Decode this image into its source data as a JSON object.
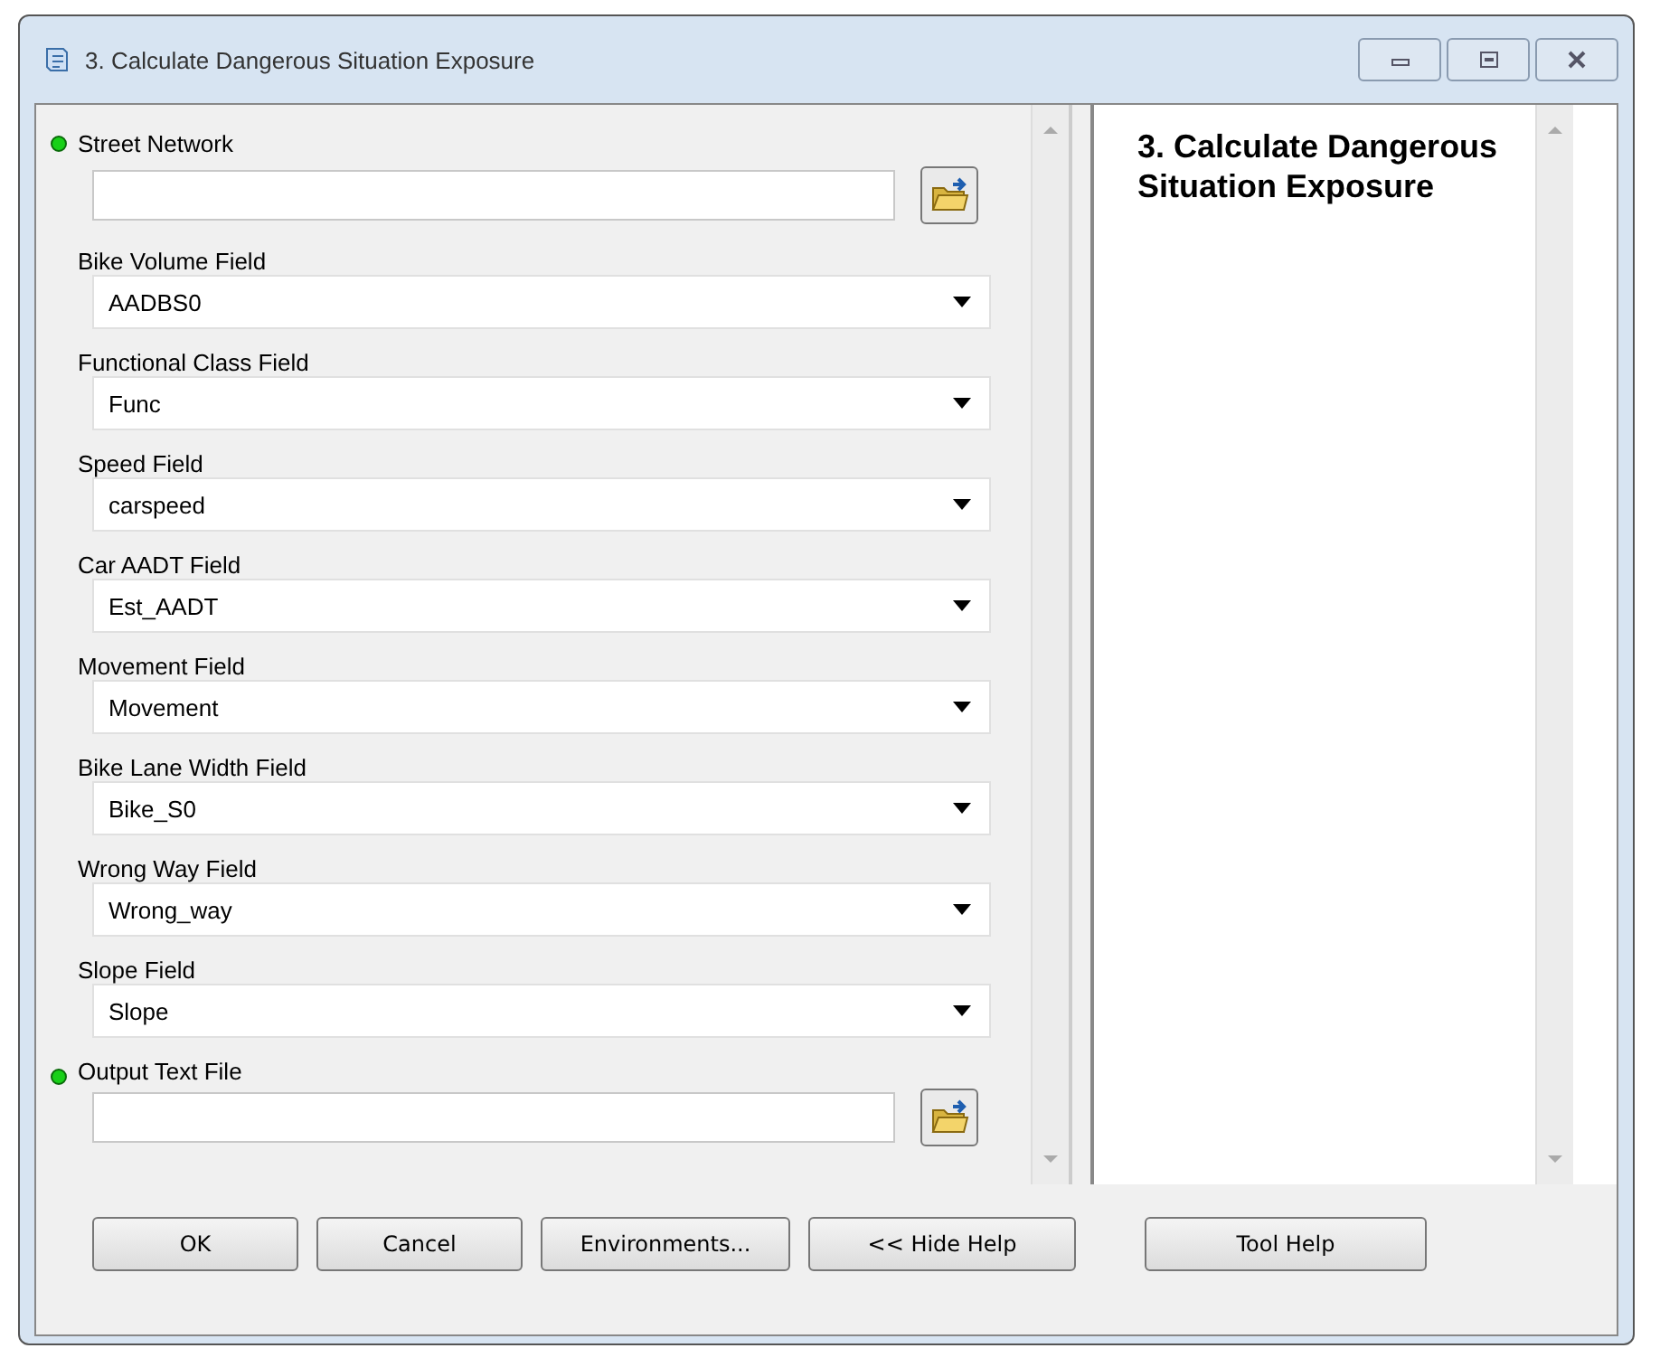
{
  "window": {
    "title": "3. Calculate Dangerous Situation Exposure"
  },
  "parameters": [
    {
      "kind": "file",
      "label": "Street Network",
      "required": true
    },
    {
      "kind": "dropdown",
      "label": "Bike Volume Field",
      "value": "AADBS0",
      "required": false
    },
    {
      "kind": "dropdown",
      "label": "Functional Class Field",
      "value": "Func",
      "required": false
    },
    {
      "kind": "dropdown",
      "label": "Speed Field",
      "value": "carspeed",
      "required": false
    },
    {
      "kind": "dropdown",
      "label": "Car AADT Field",
      "value": "Est_AADT",
      "required": false
    },
    {
      "kind": "dropdown",
      "label": "Movement Field",
      "value": "Movement",
      "required": false
    },
    {
      "kind": "dropdown",
      "label": "Bike Lane Width Field",
      "value": "Bike_S0",
      "required": false
    },
    {
      "kind": "dropdown",
      "label": "Wrong Way Field",
      "value": "Wrong_way",
      "required": false
    },
    {
      "kind": "dropdown",
      "label": "Slope Field",
      "value": "Slope",
      "required": false
    },
    {
      "kind": "file",
      "label": "Output Text File",
      "required": true
    }
  ],
  "help": {
    "title": "3. Calculate Dangerous Situation Exposure"
  },
  "buttons": [
    "OK",
    "Cancel",
    "Environments...",
    "<< Hide Help",
    "Tool Help"
  ]
}
